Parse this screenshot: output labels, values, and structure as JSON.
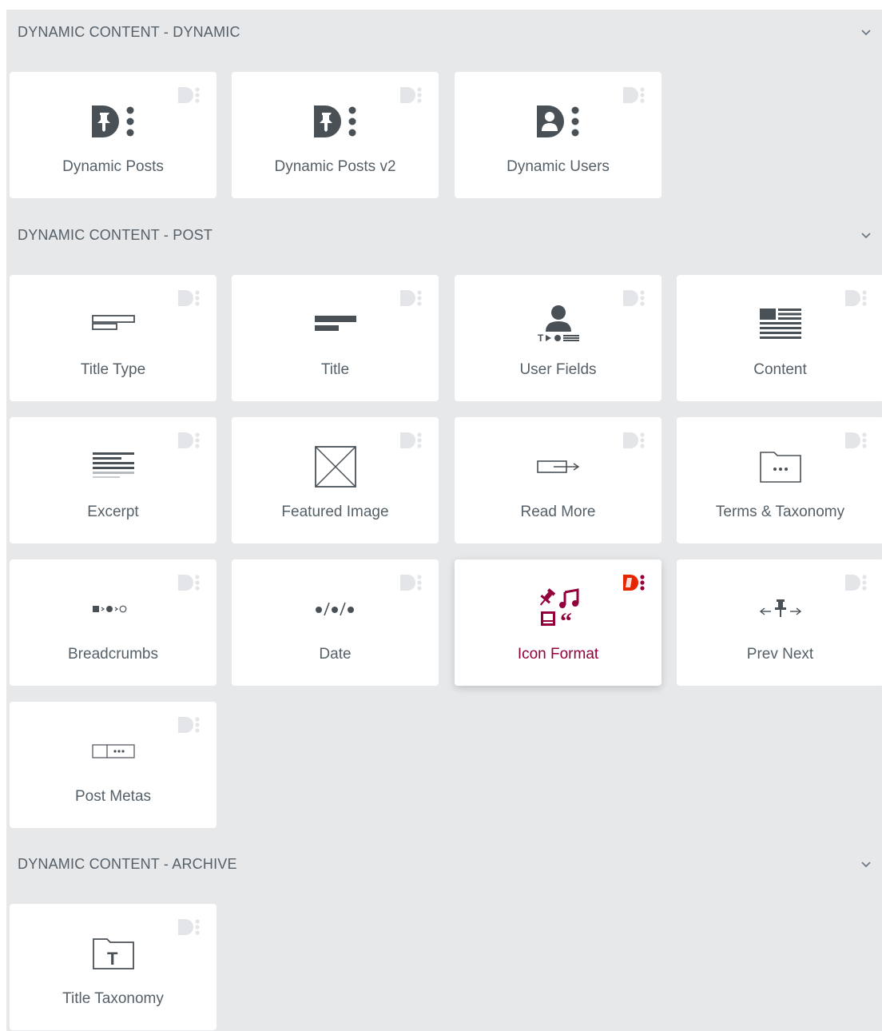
{
  "sections": [
    {
      "title": "DYNAMIC CONTENT - DYNAMIC",
      "widgets": [
        {
          "label": "Dynamic Posts",
          "icon": "dynamic-posts-icon"
        },
        {
          "label": "Dynamic Posts v2",
          "icon": "dynamic-posts-v2-icon"
        },
        {
          "label": "Dynamic Users",
          "icon": "dynamic-users-icon"
        }
      ]
    },
    {
      "title": "DYNAMIC CONTENT - POST",
      "widgets": [
        {
          "label": "Title Type",
          "icon": "title-type-icon"
        },
        {
          "label": "Title",
          "icon": "title-icon"
        },
        {
          "label": "User Fields",
          "icon": "user-fields-icon"
        },
        {
          "label": "Content",
          "icon": "content-icon"
        },
        {
          "label": "Excerpt",
          "icon": "excerpt-icon"
        },
        {
          "label": "Featured Image",
          "icon": "featured-image-icon"
        },
        {
          "label": "Read More",
          "icon": "read-more-icon"
        },
        {
          "label": "Terms & Taxonomy",
          "icon": "terms-taxonomy-icon"
        },
        {
          "label": "Breadcrumbs",
          "icon": "breadcrumbs-icon"
        },
        {
          "label": "Date",
          "icon": "date-icon"
        },
        {
          "label": "Icon Format",
          "icon": "icon-format-icon",
          "active": true
        },
        {
          "label": "Prev Next",
          "icon": "prev-next-icon"
        },
        {
          "label": "Post Metas",
          "icon": "post-metas-icon"
        }
      ]
    },
    {
      "title": "DYNAMIC CONTENT - ARCHIVE",
      "widgets": [
        {
          "label": "Title Taxonomy",
          "icon": "title-taxonomy-icon"
        }
      ]
    }
  ],
  "colors": {
    "panel_bg": "#e6e8ea",
    "card_bg": "#ffffff",
    "text": "#556068",
    "icon": "#495157",
    "badge_muted": "#e3e5e8",
    "accent": "#93003c",
    "badge_active": "#e52600"
  }
}
